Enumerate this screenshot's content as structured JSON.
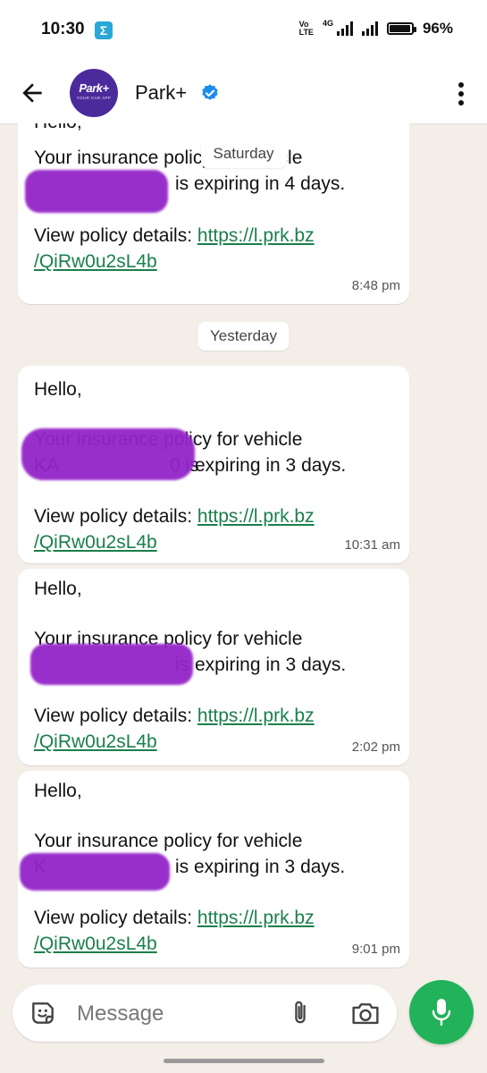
{
  "status": {
    "time": "10:30",
    "badge": "Σ",
    "volte_top": "Vo ",
    "volte_bottom": "LTE",
    "net": "4G",
    "battery_text": "96%",
    "battery_level": 0.96
  },
  "header": {
    "contact_name": "Park+",
    "avatar_logo": "Park+",
    "avatar_tagline": "YOUR CAR APP"
  },
  "dates": {
    "saturday": "Saturday",
    "yesterday": "Yesterday"
  },
  "messages": [
    {
      "partial_greeting": "Hello,",
      "line1": "Your insurance policy for vehicle",
      "line2": "is expiring in 4 days.",
      "details_label": "View policy details:",
      "link_part1": "https://l.prk.bz",
      "link_part2": "/QiRw0u2sL4b",
      "time": "8:48 pm"
    },
    {
      "greeting": "Hello,",
      "line1": "Your insurance policy for vehicle",
      "line2_prefix": "KA",
      "line2_mid": "0 is ",
      "line2_suffix": "expiring in 3 days.",
      "details_label": "View policy details:",
      "link_part1": "https://l.prk.bz",
      "link_part2": "/QiRw0u2sL4b",
      "time": "10:31 am"
    },
    {
      "greeting": "Hello,",
      "line1": "Your insurance policy for vehicle",
      "line2_mid": "is ",
      "line2_suffix": "expiring in 3 days.",
      "details_label": "View policy details:",
      "link_part1": "https://l.prk.bz",
      "link_part2": "/QiRw0u2sL4b",
      "time": "2:02 pm"
    },
    {
      "greeting": "Hello,",
      "line1": "Your insurance policy for vehicle",
      "line2_prefix": "K",
      "line2_suffix": "is expiring in 3 days.",
      "details_label": "View policy details:",
      "link_part1": "https://l.prk.bz",
      "link_part2": "/QiRw0u2sL4b",
      "time": "9:01 pm"
    }
  ],
  "composer": {
    "placeholder": "Message"
  },
  "icons": {
    "back": "arrow-left-icon",
    "verified": "verified-check-icon",
    "menu": "more-vert-icon",
    "sticker": "sticker-icon",
    "attach": "paperclip-icon",
    "camera": "camera-icon",
    "mic": "microphone-icon"
  },
  "colors": {
    "accent_green": "#21b25a",
    "link_green": "#1a7f4b",
    "verified_blue": "#1d8cf0",
    "brand_purple": "#4b2a9c",
    "redaction_purple": "#9424c8",
    "chat_background": "#f3efe8"
  }
}
